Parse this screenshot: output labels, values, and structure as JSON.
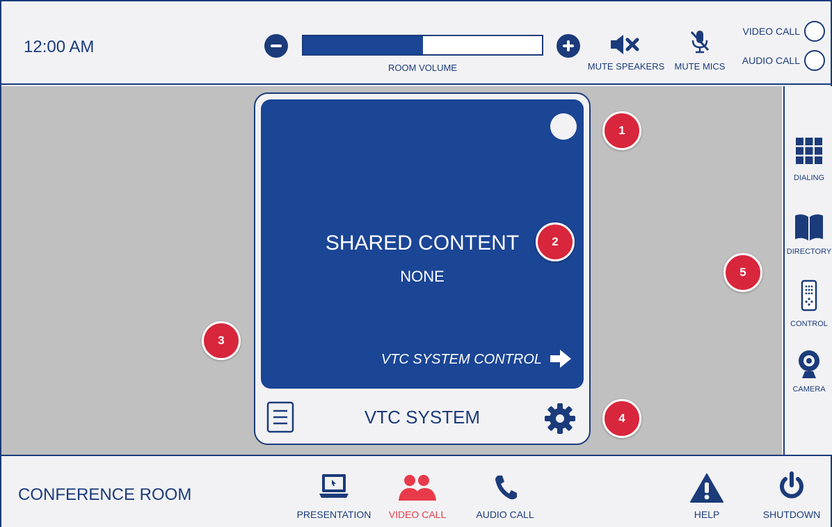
{
  "header": {
    "time": "12:00 AM",
    "volume": {
      "label": "ROOM VOLUME",
      "level": 0.5
    },
    "mute_speakers": "MUTE SPEAKERS",
    "mute_mics": "MUTE MICS",
    "call_modes": [
      {
        "label": "VIDEO CALL"
      },
      {
        "label": "AUDIO CALL"
      }
    ]
  },
  "card": {
    "shared_content_label": "SHARED CONTENT",
    "shared_content_value": "NONE",
    "control_link": "VTC SYSTEM CONTROL",
    "title": "VTC SYSTEM"
  },
  "sidebar": {
    "items": [
      {
        "label": "DIALING",
        "icon": "keypad-icon"
      },
      {
        "label": "DIRECTORY",
        "icon": "book-icon"
      },
      {
        "label": "CONTROL",
        "icon": "remote-icon"
      },
      {
        "label": "CAMERA",
        "icon": "webcam-icon"
      }
    ]
  },
  "footer": {
    "room_name": "CONFERENCE ROOM",
    "nav": [
      {
        "label": "PRESENTATION",
        "icon": "laptop-icon"
      },
      {
        "label": "VIDEO CALL",
        "icon": "people-icon"
      },
      {
        "label": "AUDIO CALL",
        "icon": "phone-icon"
      }
    ],
    "help": "HELP",
    "shutdown": "SHUTDOWN"
  },
  "badges": [
    "1",
    "2",
    "3",
    "4",
    "5"
  ],
  "colors": {
    "primary": "#1b3b7a",
    "screen": "#1b4595",
    "active": "#e83a4a",
    "badge": "#d8263c",
    "background": "#c0c0c0"
  }
}
